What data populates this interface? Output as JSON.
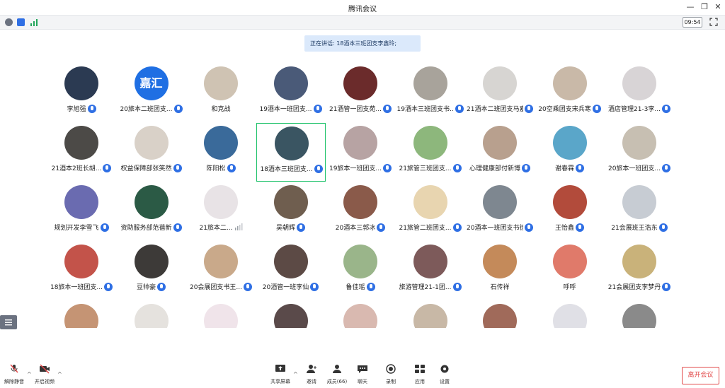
{
  "window": {
    "title": "腾讯会议"
  },
  "status": {
    "time": "09:54"
  },
  "speaking": {
    "text": "正在讲话: 18酒本三班团支李鑫玲;"
  },
  "participants": [
    {
      "name": "李旭强",
      "color": "#2b3a52"
    },
    {
      "name": "20旅本二班团支...",
      "color": "#1f6fe3",
      "text": "嘉汇"
    },
    {
      "name": "和克战",
      "color": "#cfc3b3",
      "nomic": true
    },
    {
      "name": "19酒本一班团支...",
      "color": "#4a5a78"
    },
    {
      "name": "21酒管一团支苑...",
      "color": "#6b2b2b"
    },
    {
      "name": "19酒本三班团支书...",
      "color": "#a8a39b"
    },
    {
      "name": "21酒本二班团支马嘉...",
      "color": "#d7d5d2"
    },
    {
      "name": "20空乘团支宋兵寒",
      "color": "#c9b9a8"
    },
    {
      "name": "酒店管理21-3李...",
      "color": "#d8d4d6"
    },
    {
      "name": "21酒本2班长胡...",
      "color": "#4c4a47"
    },
    {
      "name": "权益保障部张笑然",
      "color": "#d9d1c8"
    },
    {
      "name": "陈阳松",
      "color": "#3a6a9a"
    },
    {
      "name": "18酒本三班团支...",
      "color": "#3a5562",
      "active": true
    },
    {
      "name": "19旅本一班团支...",
      "color": "#b7a3a3"
    },
    {
      "name": "21旅管三班团支...",
      "color": "#8db77c"
    },
    {
      "name": "心理健康部付新博",
      "color": "#b8a08e"
    },
    {
      "name": "谢春霖",
      "color": "#5aa6c9"
    },
    {
      "name": "20旅本一班团支...",
      "color": "#c7bfb2"
    },
    {
      "name": "规划开发李雪飞",
      "color": "#6a6bb0"
    },
    {
      "name": "资助服务部范蓓新",
      "color": "#2b5a45"
    },
    {
      "name": "21旅本二...",
      "color": "#e8e3e6",
      "signal": true
    },
    {
      "name": "吴朝辉",
      "color": "#6f5e4f"
    },
    {
      "name": "20酒本三郭冰",
      "color": "#8a5a4a"
    },
    {
      "name": "21旅管二班团支...",
      "color": "#e8d5b0"
    },
    {
      "name": "20酒本一班团支书徐...",
      "color": "#7e8790"
    },
    {
      "name": "王怡鑫",
      "color": "#b24b3b"
    },
    {
      "name": "21会展班王浩东",
      "color": "#c7ccd3"
    },
    {
      "name": "18旅本一班团支...",
      "color": "#c3534a"
    },
    {
      "name": "豆帅豪",
      "color": "#3d3a38"
    },
    {
      "name": "20会展团支书王...",
      "color": "#c9a98a"
    },
    {
      "name": "20酒管一班李仙",
      "color": "#5c4a45"
    },
    {
      "name": "鲁佳瑶",
      "color": "#9ab58a"
    },
    {
      "name": "旅游管理21-1团...",
      "color": "#7d5a5a"
    },
    {
      "name": "石传祥",
      "color": "#c48a5a",
      "nomic": true
    },
    {
      "name": "呼呼",
      "color": "#e07a6a",
      "nomic": true
    },
    {
      "name": "21会展团支李梦丹",
      "color": "#c9b27a"
    },
    {
      "name": "",
      "color": "#c59474",
      "nomic": true
    },
    {
      "name": "",
      "color": "#e5e2de",
      "nomic": true
    },
    {
      "name": "",
      "color": "#f0e4ea",
      "nomic": true
    },
    {
      "name": "",
      "color": "#5a4a4a",
      "nomic": true
    },
    {
      "name": "",
      "color": "#d9b9b0",
      "nomic": true
    },
    {
      "name": "",
      "color": "#c8b8a6",
      "nomic": true
    },
    {
      "name": "",
      "color": "#a06a5a",
      "nomic": true
    },
    {
      "name": "",
      "color": "#e0e0e6",
      "nomic": true
    },
    {
      "name": "",
      "color": "#8a8a8a",
      "nomic": true
    }
  ],
  "toolbar": {
    "unmute": "解除静音",
    "start_video": "开启视频",
    "share_screen": "共享屏幕",
    "invite": "邀请",
    "members": "成员(66)",
    "chat": "聊天",
    "record": "录制",
    "apps": "应用",
    "settings": "设置",
    "leave": "离开会议"
  }
}
